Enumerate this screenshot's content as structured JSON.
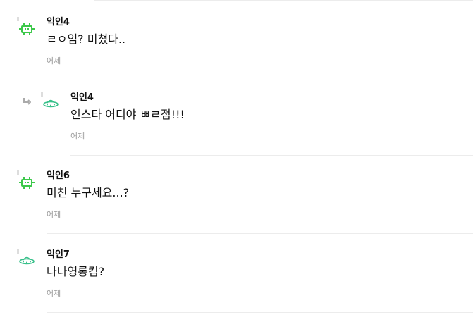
{
  "comments": [
    {
      "author": "익인4",
      "text": "ㄹㅇ임? 미쳤다..",
      "time": "어제",
      "avatar_icon": "robot-icon",
      "reply": false
    },
    {
      "author": "익인4",
      "text": "인스타 어디야 ㅃㄹ점!!!",
      "time": "어제",
      "avatar_icon": "ufo-icon",
      "reply": true
    },
    {
      "author": "익인6",
      "text": "미친 누구세요...?",
      "time": "어제",
      "avatar_icon": "robot-icon",
      "reply": false
    },
    {
      "author": "익인7",
      "text": "나나영롱킴?",
      "time": "어제",
      "avatar_icon": "ufo-icon",
      "reply": false
    }
  ],
  "colors": {
    "avatar_green": "#3cc84a",
    "avatar_teal": "#38c08a",
    "divider": "#ececec",
    "time_gray": "#999999"
  }
}
